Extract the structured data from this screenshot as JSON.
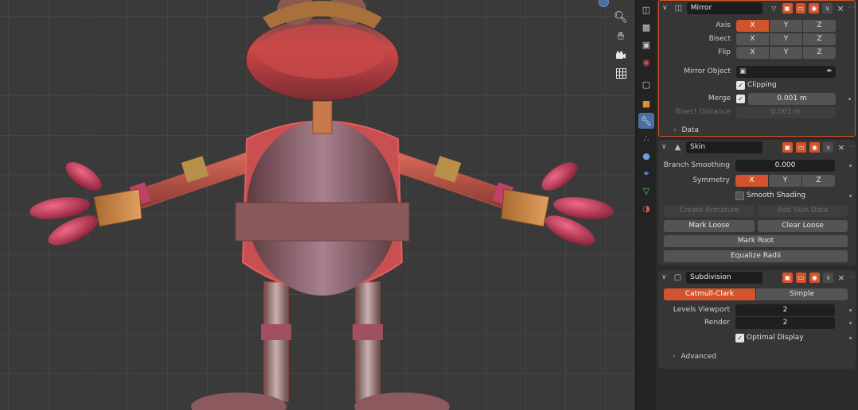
{
  "mirror": {
    "name": "Mirror",
    "axis_label": "Axis",
    "bisect_label": "Bisect",
    "flip_label": "Flip",
    "axes": [
      "X",
      "Y",
      "Z"
    ],
    "mirror_object_label": "Mirror Object",
    "clipping_label": "Clipping",
    "merge_label": "Merge",
    "merge_value": "0.001 m",
    "bisect_distance_label": "Bisect Distance",
    "bisect_distance_value": "0.001 m",
    "data_label": "Data"
  },
  "skin": {
    "name": "Skin",
    "branch_smoothing_label": "Branch Smoothing",
    "branch_smoothing_value": "0.000",
    "symmetry_label": "Symmetry",
    "axes": [
      "X",
      "Y",
      "Z"
    ],
    "smooth_shading_label": "Smooth Shading",
    "create_armature_label": "Create Armature",
    "add_skin_data_label": "Add Skin Data",
    "mark_loose_label": "Mark Loose",
    "clear_loose_label": "Clear Loose",
    "mark_root_label": "Mark Root",
    "equalize_radii_label": "Equalize Radii"
  },
  "subdivision": {
    "name": "Subdivision",
    "catmull_clark_label": "Catmull-Clark",
    "simple_label": "Simple",
    "levels_viewport_label": "Levels Viewport",
    "levels_viewport_value": "2",
    "render_label": "Render",
    "render_value": "2",
    "optimal_display_label": "Optimal Display",
    "advanced_label": "Advanced"
  },
  "colors": {
    "accent": "#d2532c",
    "active_tab": "#4b6ea3",
    "panel_bg": "#2b2b2b"
  }
}
